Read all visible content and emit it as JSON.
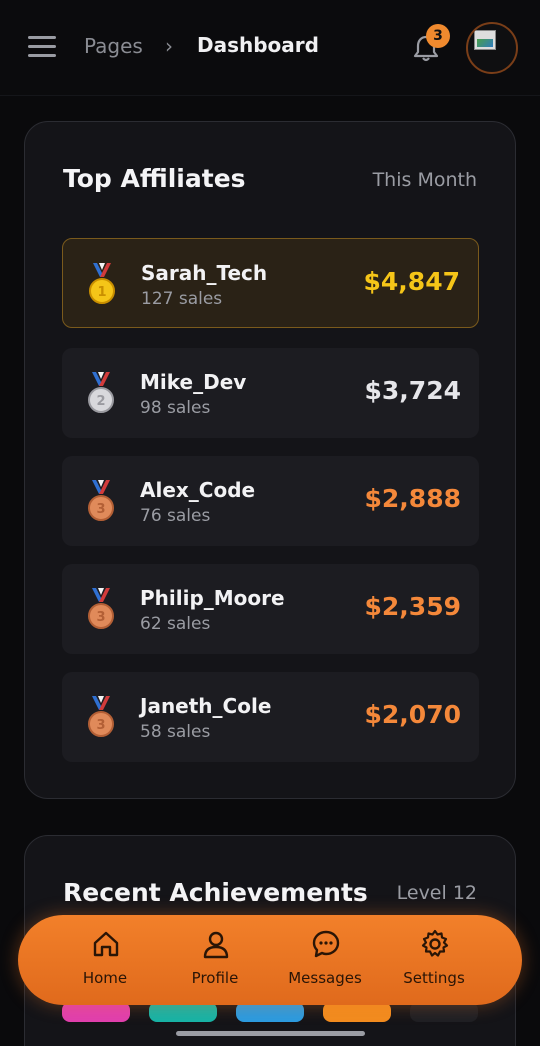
{
  "header": {
    "breadcrumb_parent": "Pages",
    "breadcrumb_separator": "›",
    "breadcrumb_current": "Dashboard",
    "notification_count": "3"
  },
  "top_affiliates": {
    "title": "Top Affiliates",
    "period": "This Month",
    "rows": [
      {
        "name": "Sarah_Tech",
        "sales": "127 sales",
        "amount": "$4,847",
        "medal_number": "1",
        "medal": "gold-medal-icon",
        "amount_color": "#f5c518"
      },
      {
        "name": "Mike_Dev",
        "sales": "98 sales",
        "amount": "$3,724",
        "medal_number": "2",
        "medal": "silver-medal-icon",
        "amount_color": "#e6e6ea"
      },
      {
        "name": "Alex_Code",
        "sales": "76 sales",
        "amount": "$2,888",
        "medal_number": "3",
        "medal": "bronze-medal-icon",
        "amount_color": "#f4883a"
      },
      {
        "name": "Philip_Moore",
        "sales": "62 sales",
        "amount": "$2,359",
        "medal_number": "3",
        "medal": "bronze-medal-icon",
        "amount_color": "#f4883a"
      },
      {
        "name": "Janeth_Cole",
        "sales": "58 sales",
        "amount": "$2,070",
        "medal_number": "3",
        "medal": "bronze-medal-icon",
        "amount_color": "#f4883a"
      }
    ]
  },
  "recent_achievements": {
    "title": "Recent Achievements",
    "level": "Level 12",
    "pill_colors": [
      "#e13fae",
      "#17b3a6",
      "#2b9be0",
      "#f28c1f",
      "#1e1f24"
    ]
  },
  "nav": {
    "items": [
      {
        "label": "Home",
        "icon": "home-icon"
      },
      {
        "label": "Profile",
        "icon": "user-icon"
      },
      {
        "label": "Messages",
        "icon": "chat-icon"
      },
      {
        "label": "Settings",
        "icon": "gear-icon"
      }
    ]
  },
  "colors": {
    "accent": "#f08a2e",
    "gold": "#f5c518",
    "silver": "#e6e6ea",
    "bronze": "#f4883a"
  }
}
